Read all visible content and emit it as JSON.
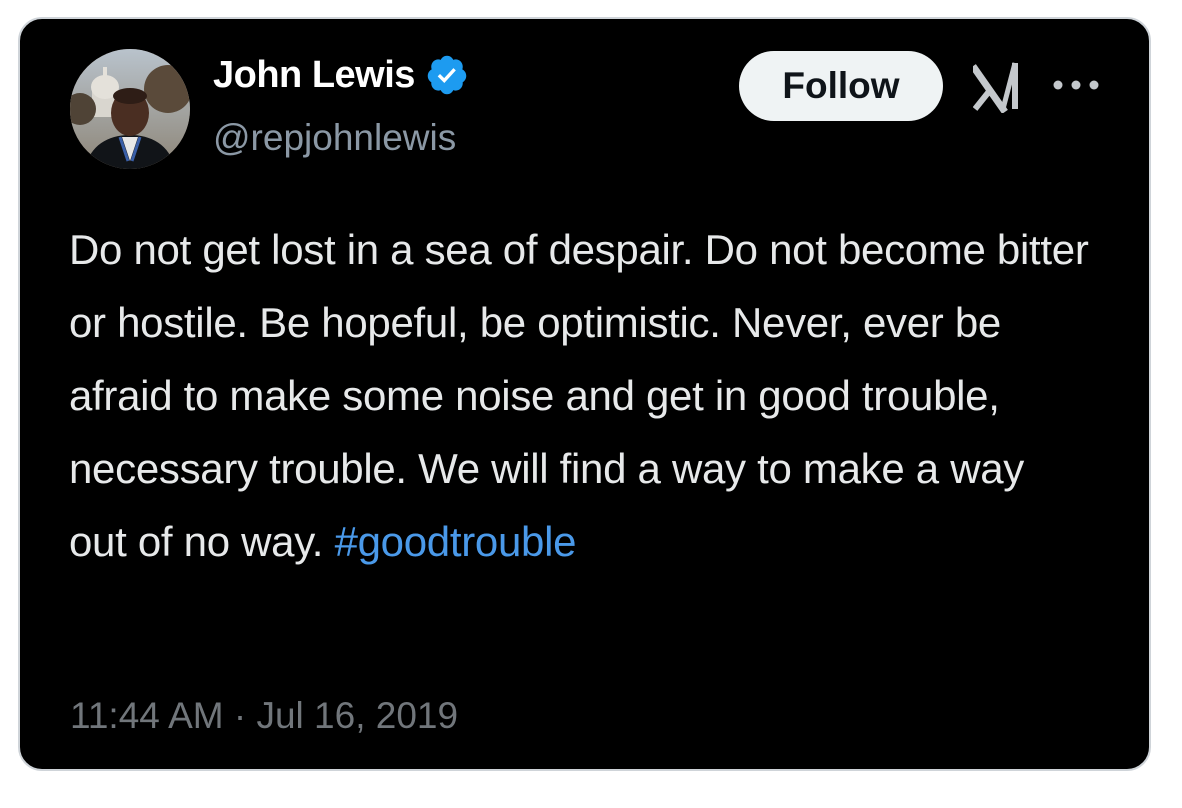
{
  "author": {
    "name": "John Lewis",
    "handle": "@repjohnlewis",
    "verified": true,
    "badge_color": "#1d9bf0"
  },
  "actions": {
    "follow_label": "Follow",
    "logo_icon": "x-logo-icon",
    "more_icon": "more-dots-icon"
  },
  "tweet": {
    "text": "Do not get lost in a sea of despair. Do not become bitter or hostile. Be hopeful, be optimistic. Never, ever be afraid to make some noise and get in good trouble, necessary trouble. We will find a way to make a way out of no way.",
    "hashtag": "#goodtrouble",
    "hashtag_color": "#4a99e9"
  },
  "meta": {
    "timestamp": "11:44 AM · Jul 16, 2019"
  }
}
